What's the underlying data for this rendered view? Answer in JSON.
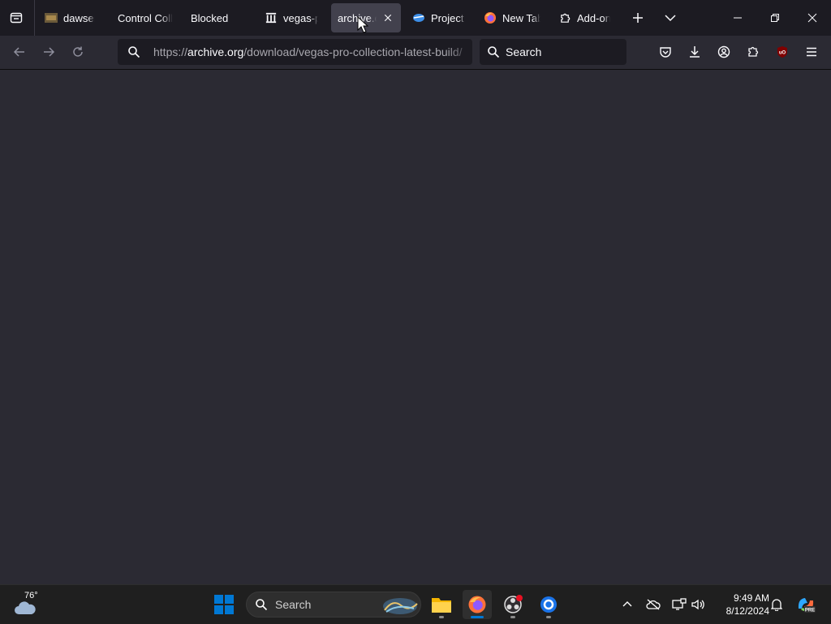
{
  "tabs": [
    {
      "label": "dawser (",
      "icon": "dawser-favicon",
      "active": false
    },
    {
      "label": "Control Colle",
      "icon": "none",
      "active": false
    },
    {
      "label": "Blocked",
      "icon": "none",
      "active": false
    },
    {
      "label": "vegas-pr",
      "icon": "archive-org-favicon",
      "active": false
    },
    {
      "label": "archive.o",
      "icon": "none",
      "active": true
    },
    {
      "label": "Project G",
      "icon": "project-favicon",
      "active": false
    },
    {
      "label": "New Tab",
      "icon": "firefox-favicon",
      "active": false
    },
    {
      "label": "Add-ons",
      "icon": "puzzle-icon",
      "active": false
    }
  ],
  "urlbar": {
    "scheme": "https://",
    "host": "archive.org",
    "path": "/download/vegas-pro-collection-latest-build/"
  },
  "searchbar": {
    "placeholder": "Search"
  },
  "taskbar": {
    "weather_temp": "76°",
    "search_placeholder": "Search",
    "time": "9:49 AM",
    "date": "8/12/2024"
  },
  "colors": {
    "tab_strip": "#1c1b22",
    "toolbar": "#2b2a33",
    "active_tab": "#42414d",
    "field": "#1c1b22",
    "taskbar": "#1f1f1f",
    "accent_windows": "#0078d4",
    "firefox_orange": "#ff7139"
  }
}
